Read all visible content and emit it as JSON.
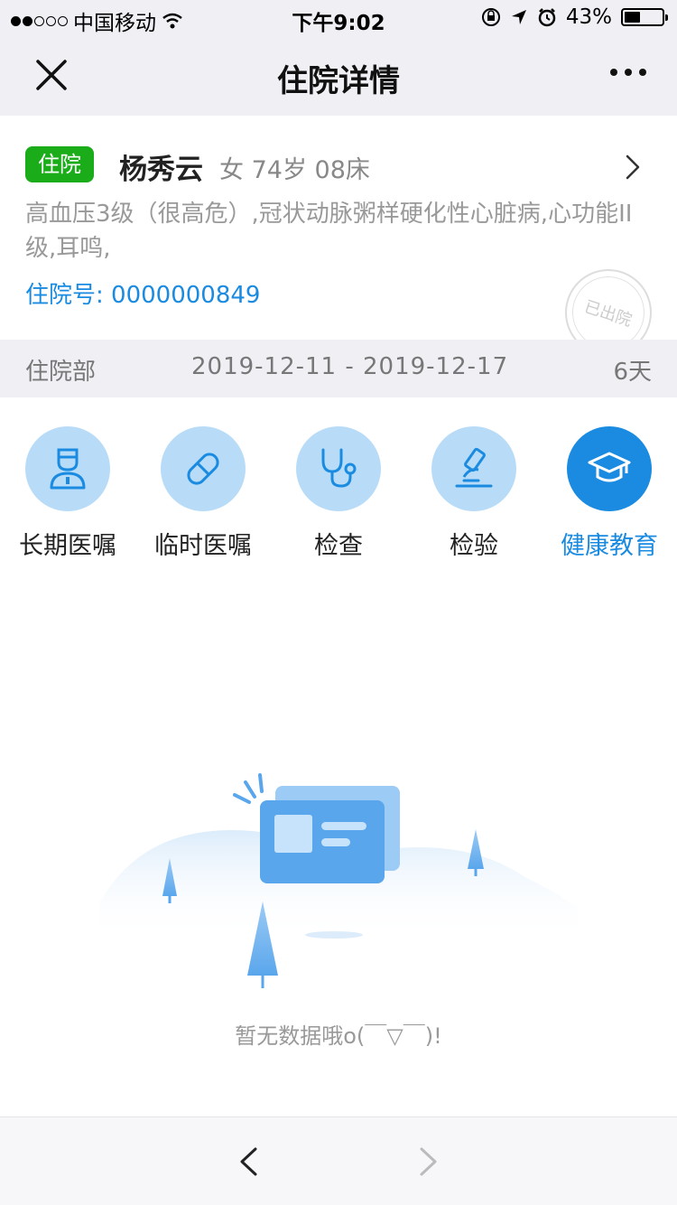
{
  "status_bar": {
    "carrier": "中国移动",
    "time": "下午9:02",
    "battery": "43%",
    "battery_level": 0.43,
    "signal_bars_filled": 2,
    "signal_bars_total": 5
  },
  "nav": {
    "title": "住院详情",
    "close_icon": "close-icon",
    "more_icon": "more-icon"
  },
  "patient": {
    "status_tag": "住院",
    "name": "杨秀云",
    "meta": "女 74岁 08床",
    "diagnosis": "高血压3级（很高危）,冠状动脉粥样硬化性心脏病,心功能II级,耳鸣,",
    "admission_no": "住院号: 0000000849",
    "stamp": "已出院",
    "tag_color": "#1aad19"
  },
  "dept": {
    "name": "住院部",
    "dates": "2019-12-11 - 2019-12-17",
    "days": "6天"
  },
  "menu": {
    "items": [
      {
        "label": "长期医嘱",
        "icon": "doctor-icon"
      },
      {
        "label": "临时医嘱",
        "icon": "pill-icon"
      },
      {
        "label": "检查",
        "icon": "stethoscope-icon"
      },
      {
        "label": "检验",
        "icon": "microscope-icon"
      },
      {
        "label": "健康教育",
        "icon": "graduation-cap-icon",
        "active": true
      }
    ],
    "accent": "#1a8be0",
    "circle_color": "#b8dcf8"
  },
  "empty": {
    "text": "暂无数据哦o(￣▽￣)!"
  },
  "bottom": {
    "back_icon": "chevron-left-icon",
    "forward_icon": "chevron-right-icon"
  }
}
